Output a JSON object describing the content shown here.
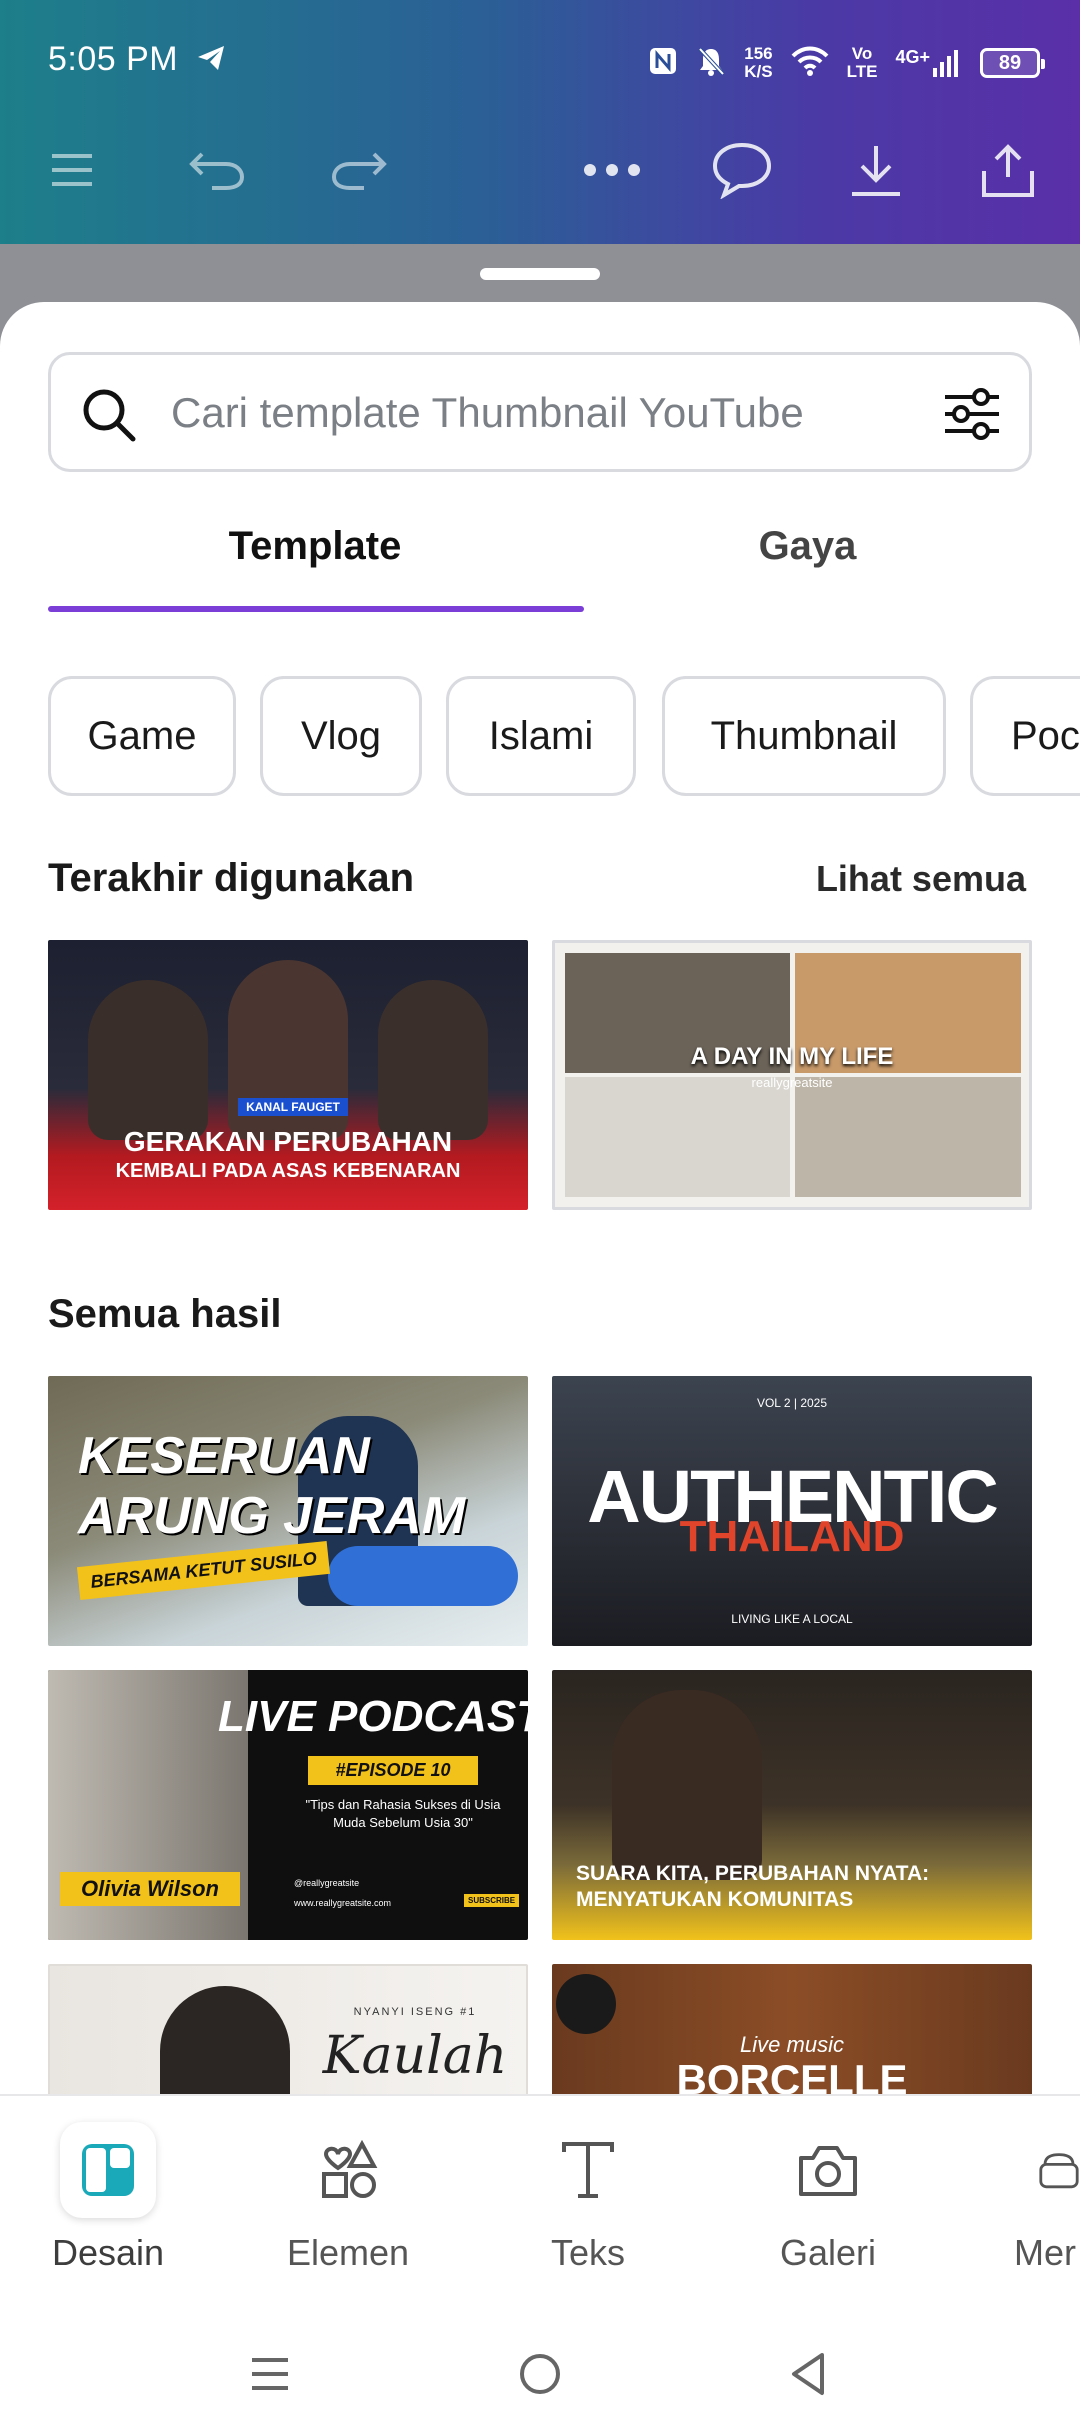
{
  "status_bar": {
    "time": "5:05 PM",
    "speed_value": "156",
    "speed_unit": "K/S",
    "volte_top": "Vo",
    "volte_bottom": "LTE",
    "network": "4G+",
    "battery": "89"
  },
  "toolbar": {
    "icons": [
      "menu-icon",
      "undo-icon",
      "redo-icon",
      "more-icon",
      "comment-icon",
      "download-icon",
      "share-icon"
    ]
  },
  "search": {
    "placeholder": "Cari template Thumbnail YouTube"
  },
  "tabs": [
    {
      "label": "Template",
      "active": true
    },
    {
      "label": "Gaya",
      "active": false
    }
  ],
  "chips": [
    "Game",
    "Vlog",
    "Islami",
    "Thumbnail",
    "Poc"
  ],
  "recent": {
    "title": "Terakhir digunakan",
    "see_all": "Lihat semua",
    "items": [
      {
        "tag": "KANAL FAUGET",
        "headline": "GERAKAN PERUBAHAN",
        "sub": "KEMBALI PADA ASAS KEBENARAN"
      },
      {
        "headline": "A DAY IN MY LIFE",
        "sub": "reallygreatsite"
      }
    ]
  },
  "all_results": {
    "title": "Semua hasil",
    "items": [
      {
        "line1": "KESERUAN",
        "line2": "ARUNG JERAM",
        "sub": "BERSAMA KETUT SUSILO"
      },
      {
        "tag": "VOL 2 | 2025",
        "line1": "AUTHENTIC",
        "line2": "THAILAND",
        "sub": "LIVING LIKE A LOCAL"
      },
      {
        "line1": "LIVE PODCAST",
        "badge": "#EPISODE 10",
        "quote": "\"Tips dan Rahasia Sukses di Usia Muda Sebelum Usia 30\"",
        "name": "Olivia Wilson",
        "site": "@reallygreatsite",
        "url": "www.reallygreatsite.com",
        "subscribe": "SUBSCRIBE"
      },
      {
        "line1": "SUARA KITA, PERUBAHAN NYATA:",
        "line2": "MENYATUKAN KOMUNITAS"
      },
      {
        "tag": "NYANYI ISENG #1",
        "line1": "Kaulah"
      },
      {
        "tag": "Live music",
        "line1": "BORCELLE"
      }
    ]
  },
  "bottom_nav": [
    {
      "label": "Desain",
      "icon": "design-icon",
      "active": true
    },
    {
      "label": "Elemen",
      "icon": "elements-icon",
      "active": false
    },
    {
      "label": "Teks",
      "icon": "text-icon",
      "active": false
    },
    {
      "label": "Galeri",
      "icon": "camera-icon",
      "active": false
    },
    {
      "label": "Mer",
      "icon": "brand-icon",
      "active": false
    }
  ],
  "colors": {
    "accent": "#7b3fd7",
    "design_teal": "#19a9b8"
  }
}
